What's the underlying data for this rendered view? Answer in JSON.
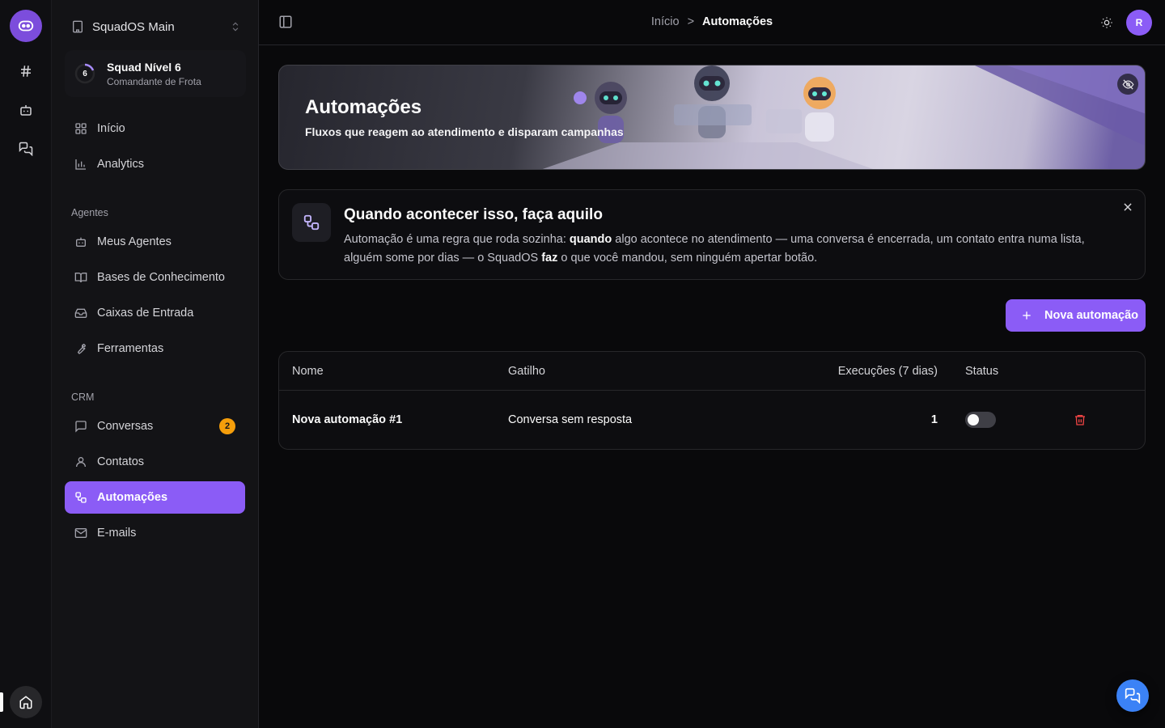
{
  "workspace": {
    "name": "SquadOS Main"
  },
  "squad": {
    "level_number": "6",
    "title": "Squad Nível 6",
    "subtitle": "Comandante de Frota"
  },
  "nav": {
    "inicio": "Início",
    "analytics": "Analytics",
    "section_agentes": "Agentes",
    "meus_agentes": "Meus Agentes",
    "bases": "Bases de Conhecimento",
    "caixas": "Caixas de Entrada",
    "ferramentas": "Ferramentas",
    "section_crm": "CRM",
    "conversas": "Conversas",
    "conversas_badge": "2",
    "contatos": "Contatos",
    "automacoes": "Automações",
    "emails": "E-mails"
  },
  "breadcrumb": {
    "home": "Início",
    "sep": ">",
    "current": "Automações"
  },
  "user": {
    "initial": "R"
  },
  "hero": {
    "title": "Automações",
    "subtitle": "Fluxos que reagem ao atendimento e disparam campanhas"
  },
  "info": {
    "title": "Quando acontecer isso, faça aquilo",
    "p1": "Automação é uma regra que roda sozinha: ",
    "b1": "quando",
    "p2": " algo acontece no atendimento — uma conversa é encerrada, um contato entra numa lista, alguém some por dias — o SquadOS ",
    "b2": "faz",
    "p3": " o que você mandou, sem ninguém apertar botão."
  },
  "actions": {
    "new_automation": "Nova automação"
  },
  "table": {
    "headers": {
      "name": "Nome",
      "trigger": "Gatilho",
      "executions": "Execuções (7 dias)",
      "status": "Status"
    },
    "rows": [
      {
        "name": "Nova automação #1",
        "trigger": "Conversa sem resposta",
        "executions": "1",
        "active": false
      }
    ]
  },
  "colors": {
    "accent": "#8b5cf6",
    "badge": "#f59e0b",
    "danger": "#ef4444",
    "fab": "#3b82f6"
  }
}
